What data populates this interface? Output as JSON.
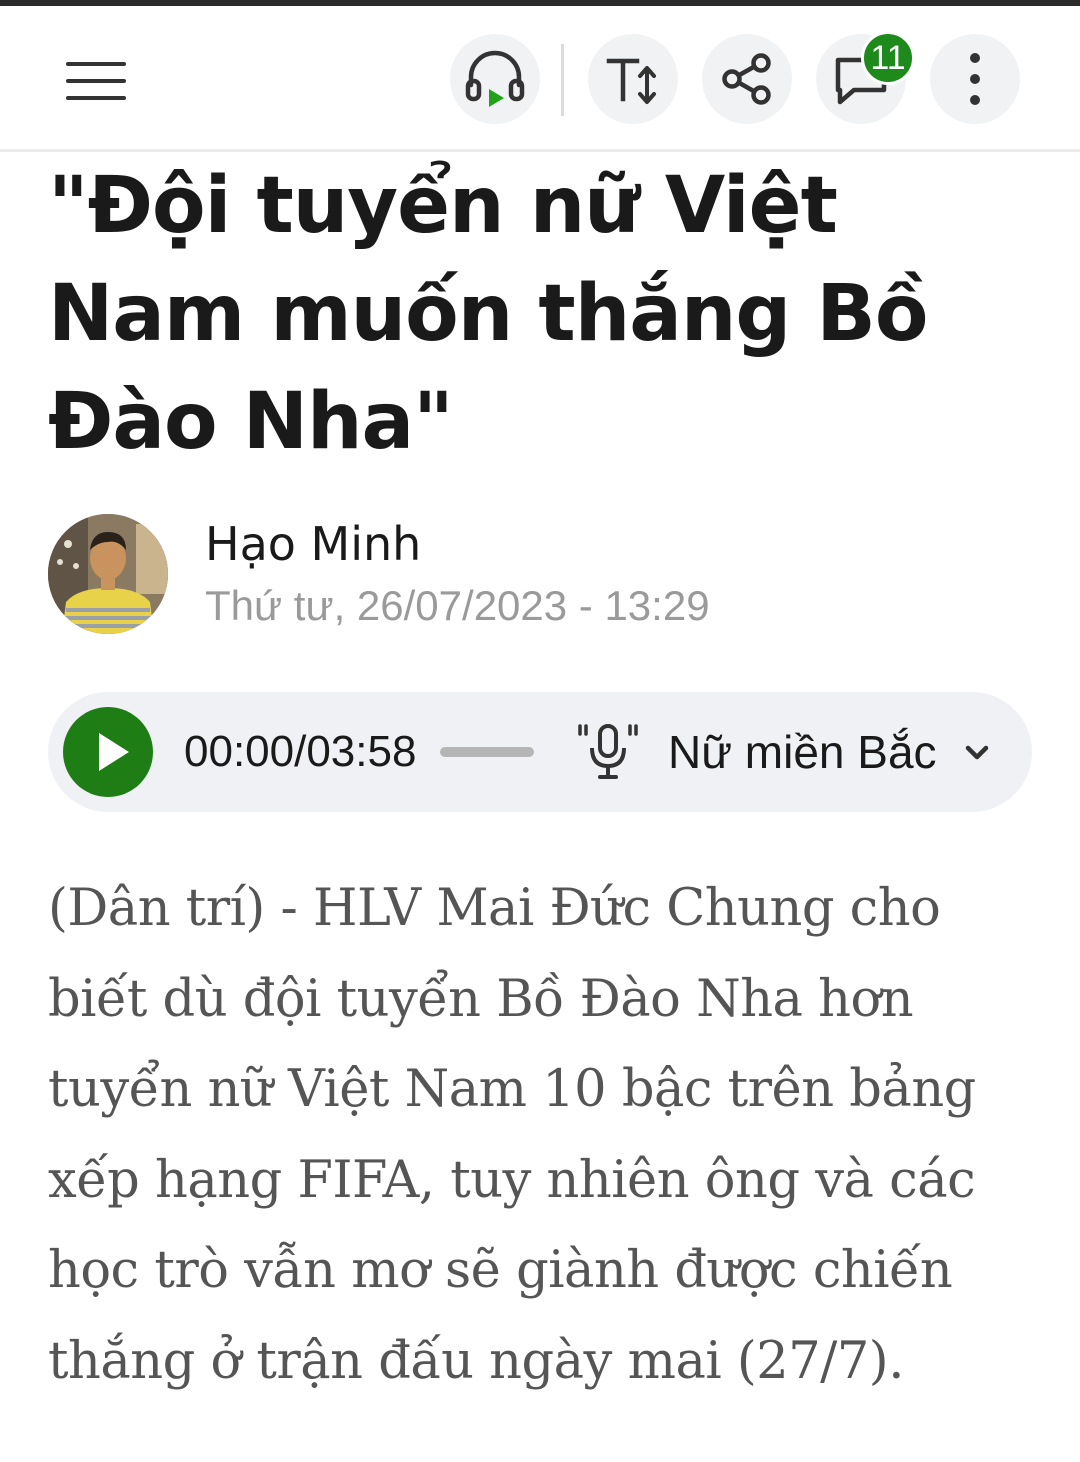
{
  "toolbar": {
    "menu_icon": "hamburger-menu-icon",
    "listen_icon": "headphones-play-icon",
    "text_size_icon": "text-size-icon",
    "share_icon": "share-icon",
    "comment_icon": "comment-icon",
    "comment_count": "11",
    "more_icon": "more-vertical-icon",
    "accent_color": "#1e8a1b"
  },
  "article": {
    "title": "\"Đội tuyển nữ Việt Nam muốn thắng Bồ Đào Nha\"",
    "author": {
      "name": "Hạo Minh",
      "date": "Thứ tư, 26/07/2023 - 13:29"
    },
    "lead": "(Dân trí) - HLV Mai Đức Chung cho biết dù đội tuyển Bồ Đào Nha hơn tuyển nữ Việt Nam 10 bậc trên bảng xếp hạng FIFA, tuy nhiên ông và các học trò vẫn mơ sẽ giành được chiến thắng ở trận đấu ngày mai (27/7)."
  },
  "audio_player": {
    "time": "00:00/03:58",
    "progress": 0,
    "voice": "Nữ miền Bắc",
    "play_color": "#1e7d14"
  }
}
